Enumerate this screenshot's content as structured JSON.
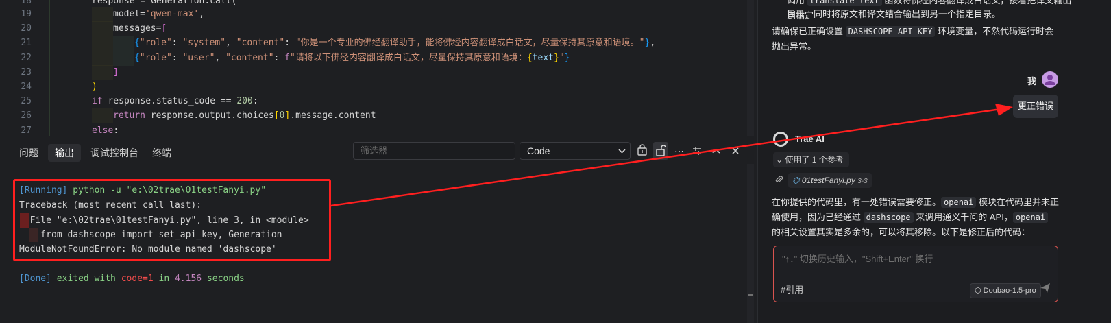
{
  "editor": {
    "lines": [
      {
        "n": "18",
        "parts": [
          [
            "plain",
            "response = Generation.call("
          ]
        ]
      },
      {
        "n": "19",
        "parts": [
          [
            "plain",
            "model="
          ],
          [
            "str",
            "'qwen-max'"
          ],
          [
            "plain",
            ","
          ]
        ]
      },
      {
        "n": "20",
        "parts": [
          [
            "plain",
            "messages="
          ],
          [
            "brace2",
            "["
          ]
        ]
      },
      {
        "n": "21",
        "parts": [
          [
            "brace3",
            "{"
          ],
          [
            "str",
            "\"role\""
          ],
          [
            "plain",
            ": "
          ],
          [
            "str",
            "\"system\""
          ],
          [
            "plain",
            ", "
          ],
          [
            "str",
            "\"content\""
          ],
          [
            "plain",
            ": "
          ],
          [
            "str",
            "\"你是一个专业的佛经翻译助手，能将佛经内容翻译成白话文，尽量保持其原意和语境。\""
          ],
          [
            "brace3",
            "}"
          ],
          [
            "plain",
            ","
          ]
        ]
      },
      {
        "n": "22",
        "parts": [
          [
            "brace3",
            "{"
          ],
          [
            "str",
            "\"role\""
          ],
          [
            "plain",
            ": "
          ],
          [
            "str",
            "\"user\""
          ],
          [
            "plain",
            ", "
          ],
          [
            "str",
            "\"content\""
          ],
          [
            "plain",
            ": "
          ],
          [
            "kw",
            "f"
          ],
          [
            "str",
            "\"请将以下佛经内容翻译成白话文，尽量保持其原意和语境："
          ],
          [
            "brace",
            "{"
          ],
          [
            "var",
            "text"
          ],
          [
            "brace",
            "}"
          ],
          [
            "str",
            "\""
          ],
          [
            "brace3",
            "}"
          ]
        ]
      },
      {
        "n": "23",
        "parts": [
          [
            "brace2",
            "]"
          ]
        ]
      },
      {
        "n": "24",
        "parts": [
          [
            "brace",
            ")"
          ]
        ]
      },
      {
        "n": "25",
        "parts": [
          [
            "kw",
            "if"
          ],
          [
            "plain",
            " response.status_code == "
          ],
          [
            "num",
            "200"
          ],
          [
            "plain",
            ":"
          ]
        ]
      },
      {
        "n": "26",
        "parts": [
          [
            "kw",
            "return"
          ],
          [
            "plain",
            " response.output.choices"
          ],
          [
            "brace",
            "["
          ],
          [
            "num",
            "0"
          ],
          [
            "brace",
            "]"
          ],
          [
            "plain",
            ".message.content"
          ]
        ]
      },
      {
        "n": "27",
        "parts": [
          [
            "kw",
            "else"
          ],
          [
            "plain",
            ":"
          ]
        ]
      }
    ]
  },
  "panel": {
    "tabs": [
      "问题",
      "输出",
      "调试控制台",
      "终端"
    ],
    "active_tab": "输出",
    "filter_placeholder": "筛选器",
    "select_value": "Code",
    "output": {
      "running_tag": "[Running]",
      "running_cmd": " python -u \"e:\\02trae\\01testFanyi.py\"",
      "traceback": "Traceback (most recent call last):",
      "file_line": "  File \"e:\\02trae\\01testFanyi.py\", line 3, in <module>",
      "import_line": "    from dashscope import set_api_key, Generation",
      "error_line": "ModuleNotFoundError: No module named 'dashscope'",
      "done_tag": "[Done]",
      "done_exited": " exited with ",
      "done_code": "code=1",
      "done_in": " in ",
      "done_secs": "4.156",
      "done_seconds": " seconds"
    }
  },
  "chat": {
    "top_line1_prefix": "调用 ",
    "top_line1_chip": "translate_text",
    "top_line1_suffix": " 函数将佛经内容翻译成白话文，接着把译文输出到指定",
    "top_line2": "目录，同时将原文和译文结合输出到另一个指定目录。",
    "env_prefix": "请确保已正确设置 ",
    "env_chip": "DASHSCOPE_API_KEY",
    "env_suffix": " 环境变量，不然代码运行时会",
    "env_line2": "抛出异常。",
    "me_label": "我",
    "user_message": "更正错误",
    "ai_name": "Trae AI",
    "ref_label": "使用了 1 个参考",
    "file_chip": "01testFanyi.py",
    "file_range": "3-3",
    "answer_prefix": "在你提供的代码里，有一处错误需要修正。",
    "answer_chip1": "openai",
    "answer_mid1": " 模块在代码里并未正",
    "answer_l2_prefix": "确使用，因为已经通过 ",
    "answer_chip2": "dashscope",
    "answer_l2_mid": " 来调用通义千问的 API，",
    "answer_chip3": "openai",
    "answer_l3": "的相关设置其实是多余的，可以将其移除。以下是修正后的代码：",
    "input_placeholder": "\"↑↓\" 切换历史输入，\"Shift+Enter\" 换行",
    "quote_label": "#引用",
    "model_label": "Doubao-1.5-pro"
  },
  "colors": {
    "accent_red": "#ff1f1f",
    "input_border": "#d9534f",
    "avatar_purple": "#c79be4"
  }
}
